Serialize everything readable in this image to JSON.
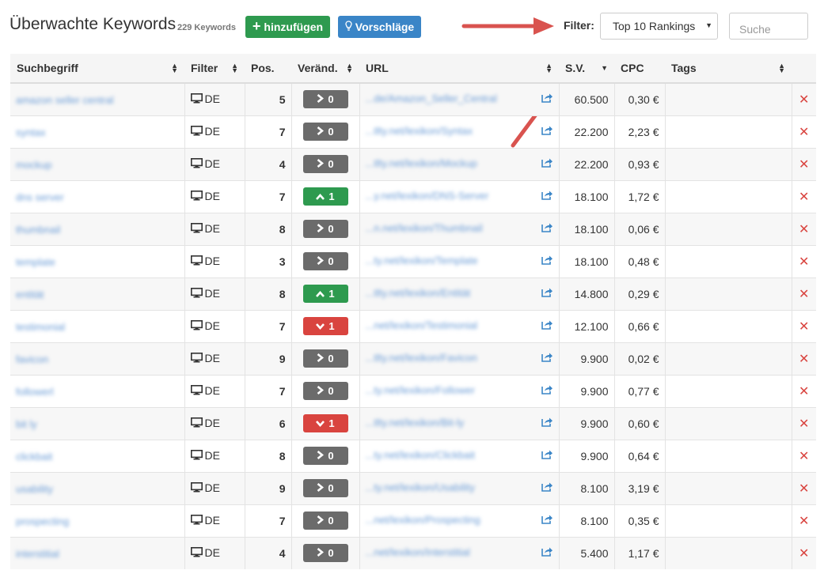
{
  "header": {
    "title": "Überwachte Keywords",
    "count": "229 Keywords",
    "add_label": "hinzufügen",
    "suggestions_label": "Vorschläge",
    "filter_label": "Filter:",
    "filter_value": "Top 10 Rankings",
    "search_placeholder": "Suche"
  },
  "colors": {
    "accent_green": "#2e9a4f",
    "accent_blue": "#3a85c7",
    "danger": "#d9443f",
    "neutral": "#6b6b6b",
    "arrow": "#d9534f"
  },
  "columns": [
    "Suchbegriff",
    "Filter",
    "Pos.",
    "Veränd.",
    "URL",
    "S.V.",
    "CPC",
    "Tags"
  ],
  "rows": [
    {
      "keyword": "amazon seller central",
      "filter": "DE",
      "pos": "5",
      "change": "0",
      "dir": "neutral",
      "url": "...de/Amazon_Seller_Central",
      "sv": "60.500",
      "cpc": "0,30 €"
    },
    {
      "keyword": "syntax",
      "filter": "DE",
      "pos": "7",
      "change": "0",
      "dir": "neutral",
      "url": "...tlty.net/lexikon/Syntax",
      "sv": "22.200",
      "cpc": "2,23 €"
    },
    {
      "keyword": "mockup",
      "filter": "DE",
      "pos": "4",
      "change": "0",
      "dir": "neutral",
      "url": "...tlty.net/lexikon/Mockup",
      "sv": "22.200",
      "cpc": "0,93 €"
    },
    {
      "keyword": "dns server",
      "filter": "DE",
      "pos": "7",
      "change": "1",
      "dir": "up",
      "url": "...y.net/lexikon/DNS-Server",
      "sv": "18.100",
      "cpc": "1,72 €"
    },
    {
      "keyword": "thumbnail",
      "filter": "DE",
      "pos": "8",
      "change": "0",
      "dir": "neutral",
      "url": "...n.net/lexikon/Thumbnail",
      "sv": "18.100",
      "cpc": "0,06 €"
    },
    {
      "keyword": "template",
      "filter": "DE",
      "pos": "3",
      "change": "0",
      "dir": "neutral",
      "url": "...ty.net/lexikon/Template",
      "sv": "18.100",
      "cpc": "0,48 €"
    },
    {
      "keyword": "entität",
      "filter": "DE",
      "pos": "8",
      "change": "1",
      "dir": "up",
      "url": "...tlty.net/lexikon/Entität",
      "sv": "14.800",
      "cpc": "0,29 €"
    },
    {
      "keyword": "testimonial",
      "filter": "DE",
      "pos": "7",
      "change": "1",
      "dir": "down",
      "url": "...net/lexikon/Testimonial",
      "sv": "12.100",
      "cpc": "0,66 €"
    },
    {
      "keyword": "favicon",
      "filter": "DE",
      "pos": "9",
      "change": "0",
      "dir": "neutral",
      "url": "...tlty.net/lexikon/Favicon",
      "sv": "9.900",
      "cpc": "0,02 €"
    },
    {
      "keyword": "followerl",
      "filter": "DE",
      "pos": "7",
      "change": "0",
      "dir": "neutral",
      "url": "...ty.net/lexikon/Follower",
      "sv": "9.900",
      "cpc": "0,77 €"
    },
    {
      "keyword": "bit ly",
      "filter": "DE",
      "pos": "6",
      "change": "1",
      "dir": "down",
      "url": "...tlty.net/lexikon/Bit-ly",
      "sv": "9.900",
      "cpc": "0,60 €"
    },
    {
      "keyword": "clickbait",
      "filter": "DE",
      "pos": "8",
      "change": "0",
      "dir": "neutral",
      "url": "...ty.net/lexikon/Clickbait",
      "sv": "9.900",
      "cpc": "0,64 €"
    },
    {
      "keyword": "usability",
      "filter": "DE",
      "pos": "9",
      "change": "0",
      "dir": "neutral",
      "url": "...ty.net/lexikon/Usability",
      "sv": "8.100",
      "cpc": "3,19 €"
    },
    {
      "keyword": "prospecting",
      "filter": "DE",
      "pos": "7",
      "change": "0",
      "dir": "neutral",
      "url": "...net/lexikon/Prospecting",
      "sv": "8.100",
      "cpc": "0,35 €"
    },
    {
      "keyword": "interstitial",
      "filter": "DE",
      "pos": "4",
      "change": "0",
      "dir": "neutral",
      "url": "...net/lexikon/Interstitial",
      "sv": "5.400",
      "cpc": "1,17 €"
    }
  ]
}
